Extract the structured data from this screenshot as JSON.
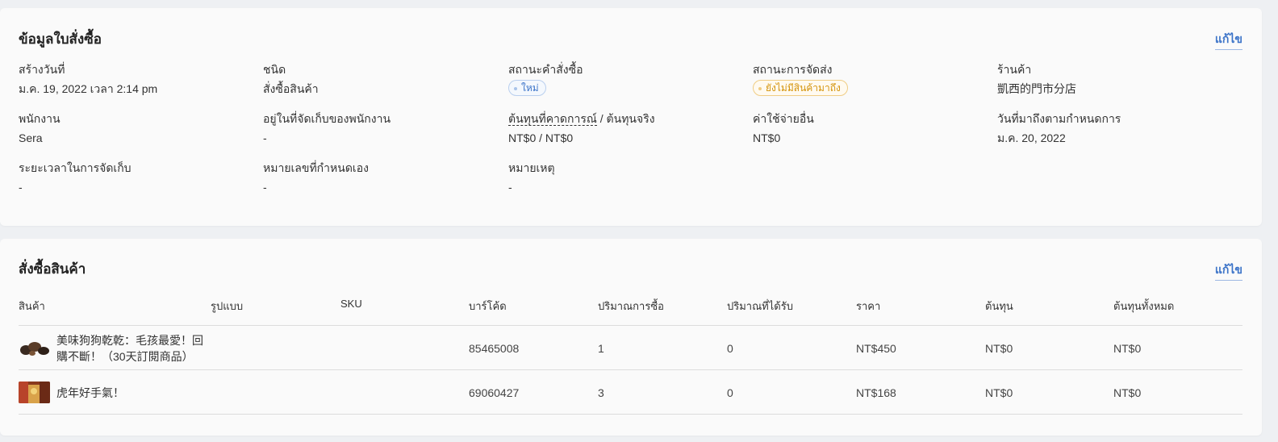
{
  "order_info": {
    "title": "ข้อมูลใบสั่งซื้อ",
    "edit_label": "แก้ไข",
    "fields": {
      "created": {
        "label": "สร้างวันที่",
        "value": "ม.ค. 19, 2022 เวลา 2:14 pm"
      },
      "type": {
        "label": "ชนิด",
        "value": "สั่งซื้อสินค้า"
      },
      "order_status": {
        "label": "สถานะคำสั่งซื้อ",
        "value": "ใหม่"
      },
      "shipping_status": {
        "label": "สถานะการจัดส่ง",
        "value": "ยังไม่มีสินค้ามาถึง"
      },
      "store": {
        "label": "ร้านค้า",
        "value": "凱西的門市分店"
      },
      "employee": {
        "label": "พนักงาน",
        "value": "Sera"
      },
      "employee_location": {
        "label": "อยู่ในที่จัดเก็บของพนักงาน",
        "value": "-"
      },
      "cost": {
        "label_dotted": "ต้นทุนที่คาดการณ์",
        "label_rest": " / ต้นทุนจริง",
        "value": "NT$0 / NT$0"
      },
      "other_expenses": {
        "label": "ค่าใช้จ่ายอื่น",
        "value": "NT$0"
      },
      "due_date": {
        "label": "วันที่มาถึงตามกำหนดการ",
        "value": "ม.ค. 20, 2022"
      },
      "storage_time": {
        "label": "ระยะเวลาในการจัดเก็บ",
        "value": "-"
      },
      "custom_number": {
        "label": "หมายเลขที่กำหนดเอง",
        "value": "-"
      },
      "note": {
        "label": "หมายเหตุ",
        "value": "-"
      }
    }
  },
  "order_items": {
    "title": "สั่งซื้อสินค้า",
    "edit_label": "แก้ไข",
    "columns": [
      "สินค้า",
      "รูปแบบ",
      "SKU",
      "บาร์โค้ด",
      "ปริมาณการซื้อ",
      "ปริมาณที่ได้รับ",
      "ราคา",
      "ต้นทุน",
      "ต้นทุนทั้งหมด"
    ],
    "rows": [
      {
        "product": "美味狗狗乾乾：毛孩最愛！回購不斷！（30天訂閱商品）",
        "variant": "",
        "sku": "",
        "barcode": "85465008",
        "qty_ordered": "1",
        "qty_received": "0",
        "price": "NT$450",
        "cost": "NT$0",
        "total_cost": "NT$0"
      },
      {
        "product": "虎年好手氣！",
        "variant": "",
        "sku": "",
        "barcode": "69060427",
        "qty_ordered": "3",
        "qty_received": "0",
        "price": "NT$168",
        "cost": "NT$0",
        "total_cost": "NT$0"
      }
    ]
  },
  "colors": {
    "accent": "#3b73c8",
    "tag_new": "#3b73c8",
    "tag_shipping": "#d4930a"
  }
}
